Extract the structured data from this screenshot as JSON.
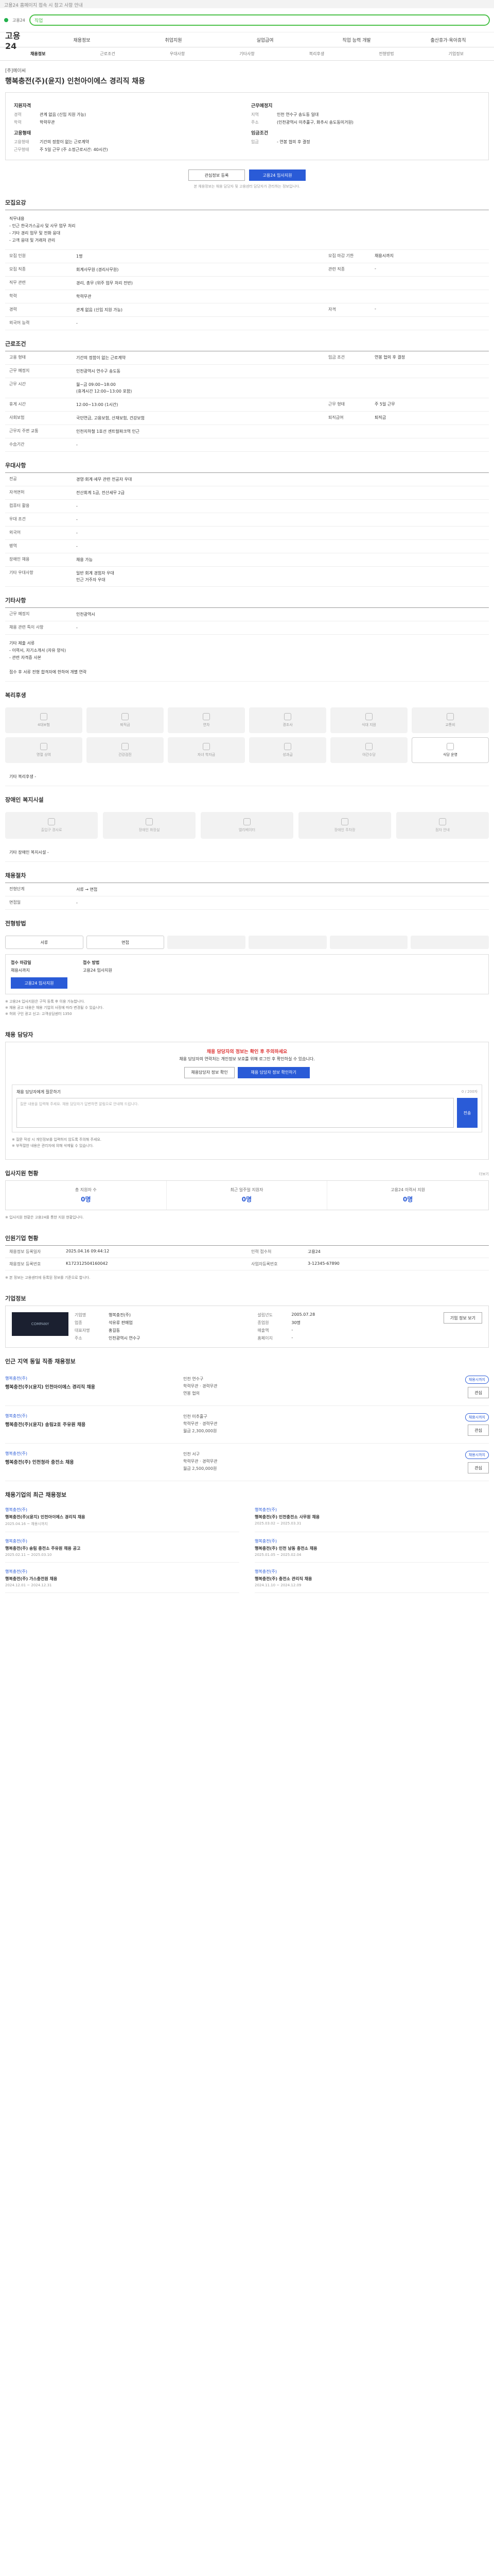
{
  "notice": "고용24 홈페이지 접속 시 참고 사항 안내",
  "topbar": {
    "logo_text": "고용24",
    "search_placeholder": "직업"
  },
  "nav": {
    "brand": "고용24",
    "items": [
      "채용정보",
      "취업지원",
      "실업급여",
      "직업 능력 개발",
      "출산휴가·육아휴직"
    ]
  },
  "tabs": [
    {
      "label": "채용정보",
      "on": true
    },
    {
      "label": "근로조건",
      "on": false
    },
    {
      "label": "우대사항",
      "on": false
    },
    {
      "label": "기타사항",
      "on": false
    },
    {
      "label": "복리후생",
      "on": false
    },
    {
      "label": "전형방법",
      "on": false
    },
    {
      "label": "기업정보",
      "on": false
    }
  ],
  "header": {
    "company": "[주]에이씨",
    "title": "행복충전(주)(윤지) 인천아이에스 경리직 채용"
  },
  "summary": {
    "left_title": "지원자격",
    "left": [
      {
        "k": "경력",
        "v": "관계 없음 (신입 지원 가능)"
      },
      {
        "k": "학력",
        "v": "학력무관"
      }
    ],
    "left2_title": "고용형태",
    "left2": [
      {
        "k": "고용형태",
        "v": "기간의 정함이 없는 근로계약"
      },
      {
        "k": "근무형태",
        "v": "주 5일 근무 (주 소정근로시간: 40시간)"
      }
    ],
    "right_title": "근무예정지",
    "right": [
      {
        "k": "지역",
        "v": "인천 연수구 송도동 일대"
      },
      {
        "k": "주소",
        "v": "(인천광역시 미추홀구, 화추시 송도동미거원)"
      }
    ],
    "right2_title": "임금조건",
    "right2": [
      {
        "k": "임금",
        "v": "- 연봉 협의 후 결정"
      }
    ]
  },
  "actions": {
    "save": "관심정보 등록",
    "apply": "고용24 입사지원"
  },
  "apply_note": "본 채용정보는 채용 담당자 및 고용센터 담당자가 관리하는 정보입니다.",
  "sections": {
    "recruit": "모집요강",
    "conditions": "근로조건",
    "prefer": "우대사항",
    "etc": "기타사항",
    "welfare": "복리후생",
    "disability": "장애인 복지시설",
    "process": "채용절차",
    "selection": "전형방법",
    "contact": "채용 담당자",
    "stats": "입사지원 현황",
    "company_stats": "인원기업 현황",
    "company": "기업정보",
    "other_jobs": "인근 지역 동일 직종 채용정보",
    "biz": "채용기업의 최근 채용정보"
  },
  "recruit": {
    "intro": "직무내용\n- 인근 한국가스공사 및 사무 업무 처리\n- 기타 경리 업무 및 전화 응대\n- 고객 응대 및 거래처 관리",
    "rows": [
      {
        "k": "모집 인원",
        "v": "1명",
        "k2": "모집 마감 기한",
        "v2": "채용시까지"
      },
      {
        "k": "모집 직종",
        "v": "회계사무원 (경리사무원)",
        "k2": "관련 직종",
        "v2": "-"
      },
      {
        "k": "직무 관련",
        "v": "경리, 총무 (위주 업무 처리 전반)",
        "k2": "",
        "v2": ""
      },
      {
        "k": "학력",
        "v": "학력무관",
        "k2": "",
        "v2": ""
      },
      {
        "k": "경력",
        "v": "관계 없음 (신입 지원 가능)",
        "k2": "자격",
        "v2": "-"
      },
      {
        "k": "외국어 능력",
        "v": "-",
        "k2": "",
        "v2": ""
      }
    ]
  },
  "conditions": {
    "rows": [
      {
        "k": "고용 형태",
        "v": "기간의 정함이 없는 근로계약",
        "k2": "임금 조건",
        "v2": "연봉 협의 후 결정"
      },
      {
        "k": "근무 예정지",
        "v": "인천광역시 연수구 송도동",
        "k2": "",
        "v2": ""
      },
      {
        "k": "근무 시간",
        "v": "월~금 09:00~18:00\n(휴게시간 12:00~13:00 포함)",
        "k2": "",
        "v2": ""
      },
      {
        "k": "휴게 시간",
        "v": "12:00~13:00 (1시간)",
        "k2": "근무 형태",
        "v2": "주 5일 근무"
      },
      {
        "k": "사회보험",
        "v": "국민연금, 고용보험, 산재보험, 건강보험",
        "k2": "퇴직급여",
        "v2": "퇴직금"
      },
      {
        "k": "근무지 주변 교통",
        "v": "인천지하철 1호선 센트럴파크역 인근",
        "k2": "",
        "v2": ""
      },
      {
        "k": "수습기간",
        "v": "-",
        "k2": "",
        "v2": ""
      }
    ],
    "map_label": "지도 보기"
  },
  "prefer": {
    "rows": [
      {
        "k": "전공",
        "v": "경영·회계·세무 관련 전공자 우대"
      },
      {
        "k": "자격면허",
        "v": "전산회계 1급, 전산세무 2급"
      },
      {
        "k": "컴퓨터 활용",
        "v": "-"
      },
      {
        "k": "우대 조건",
        "v": "-"
      },
      {
        "k": "외국어",
        "v": "-"
      },
      {
        "k": "병역",
        "v": "-"
      },
      {
        "k": "장애인 채용",
        "v": "채용 가능"
      },
      {
        "k": "기타 우대사항",
        "v": "일반 회계 경험자 우대\n인근 거주자 우대"
      }
    ]
  },
  "etc": {
    "rows": [
      {
        "k": "근무 예정지",
        "v": "인천광역시"
      },
      {
        "k": "채용 관련 특이 사항",
        "v": "-"
      }
    ],
    "block": "기타 제출 서류\n- 이력서, 자기소개서 (자유 양식)\n- 관련 자격증 사본\n\n접수 후 서류 전형 합격자에 한하여 개별 연락"
  },
  "welfare": {
    "items": [
      "4대보험",
      "퇴직금",
      "연차",
      "경조사",
      "식대 지원",
      "교통비",
      "명절 상여",
      "건강검진",
      "자녀 학자금",
      "성과급",
      "야간수당",
      "식당 운영"
    ],
    "on": [
      11
    ],
    "note": "기타 복리후생 -"
  },
  "disability": {
    "items": [
      "출입구 경사로",
      "장애인 화장실",
      "엘리베이터",
      "장애인 주차장",
      "점자 안내"
    ],
    "note": "기타 장애인 복지시설 -"
  },
  "process": {
    "steps": [
      "서류",
      "면접",
      "",
      "",
      "",
      ""
    ],
    "on": [
      0,
      1
    ]
  },
  "selection": {
    "c1_title": "접수 마감일",
    "c1_val": "채용시까지",
    "c2_title": "접수 방법",
    "c2_val": "고용24 입사지원",
    "apply_btn": "고용24 입사지원",
    "fine": "※ 고용24 입사지원은 구직 등록 후 이용 가능합니다.\n※ 채용 공고 내용은 채용 기업의 사정에 따라 변경될 수 있습니다.\n※ 허위 구인 광고 신고: 고객상담센터 1350"
  },
  "contact": {
    "warn": "채용 담당자의 정보는 확인 후 주의하세요",
    "desc": "채용 담당자의 연락처는 개인정보 보호를 위해 로그인 후 확인하실 수 있습니다.",
    "btn1": "채용담당자 정보 확인",
    "btn2": "채용 담당자 정보 확인하기",
    "q_title": "채용 담당자에게 질문하기",
    "q_sub": "0 / 200자",
    "q_placeholder": "질문 내용을 입력해 주세요. 채용 담당자가 답변하면 알림으로 안내해 드립니다.",
    "q_send": "전송",
    "fine": "※ 질문 작성 시 개인정보를 입력하지 않도록 주의해 주세요.\n※ 부적절한 내용은 관리자에 의해 삭제될 수 있습니다."
  },
  "stats": {
    "more": "더보기",
    "items": [
      {
        "label": "총 지원자 수",
        "val": "0명"
      },
      {
        "label": "최근 일주일 지원자",
        "val": "0명"
      },
      {
        "label": "고용24 이력서 지원",
        "val": "0명"
      }
    ],
    "fine": "※ 입사지원 현황은 고용24를 통한 지원 현황입니다."
  },
  "company_stats": {
    "rows": [
      [
        "채용정보 등록일자",
        "2025.04.16 09:44:12",
        "인력 접수처",
        "고용24"
      ],
      [
        "채용정보 등록번호",
        "K172312504160042",
        "사업자등록번호",
        "3-12345-67890"
      ]
    ],
    "fine": "※ 본 정보는 고용센터에 등록된 정보를 기준으로 합니다."
  },
  "company": {
    "logo_text": "COMPANY",
    "rows": [
      [
        "기업명",
        "행복충전(주)",
        "설립년도",
        "2005.07.28"
      ],
      [
        "업종",
        "석유류 판매업",
        "종업원",
        "30명"
      ],
      [
        "대표자명",
        "홍길동",
        "매출액",
        "-"
      ],
      [
        "주소",
        "인천광역시 연수구",
        "홈페이지",
        "-"
      ]
    ],
    "btn": "기업 정보 보기"
  },
  "other_jobs": [
    {
      "co": "행복충전(주)",
      "title": "행복충전(주)(윤지) 인천아이에스 경리직 채용",
      "meta": "인천 연수구\n학력무관 · 경력무관\n연봉 협의",
      "tag": "채용시까지"
    },
    {
      "co": "행복충전(주)",
      "title": "행복충전(주)(윤지) 송림2호 주유원 채용",
      "meta": "인천 미추홀구\n학력무관 · 경력무관\n월급 2,300,000원",
      "tag": "채용시까지"
    },
    {
      "co": "행복충전(주)",
      "title": "행복충전(주) 인천청라 충전소 채용",
      "meta": "인천 서구\n학력무관 · 경력무관\n월급 2,500,000원",
      "tag": "채용시까지"
    }
  ],
  "biz": [
    {
      "co": "행복충전(주)",
      "title": "행복충전(주)(윤지) 인천아이에스 경리직 채용",
      "date": "2025.04.16 ~ 채용시까지"
    },
    {
      "co": "행복충전(주)",
      "title": "행복충전(주) 인천충전소 사무원 채용",
      "date": "2025.03.02 ~ 2025.03.31"
    },
    {
      "co": "행복충전(주)",
      "title": "행복충전(주) 송림 충전소 주유원 채용 공고",
      "date": "2025.02.11 ~ 2025.03.10"
    },
    {
      "co": "행복충전(주)",
      "title": "행복충전(주) 인천 남동 충전소 채용",
      "date": "2025.01.05 ~ 2025.02.04"
    },
    {
      "co": "행복충전(주)",
      "title": "행복충전(주) 가스충전원 채용",
      "date": "2024.12.01 ~ 2024.12.31"
    },
    {
      "co": "행복충전(주)",
      "title": "행복충전(주) 충전소 관리직 채용",
      "date": "2024.11.10 ~ 2024.12.09"
    }
  ]
}
